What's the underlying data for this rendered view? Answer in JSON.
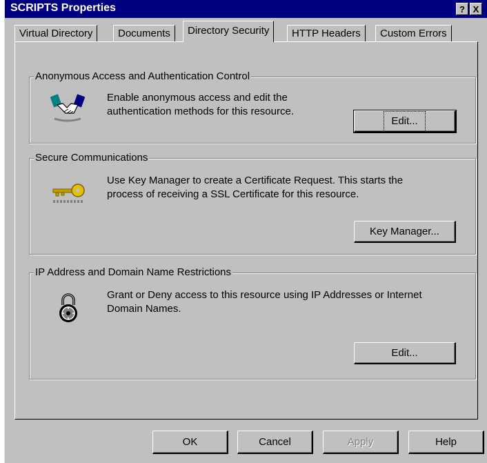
{
  "window": {
    "title": "SCRIPTS Properties"
  },
  "titlebar": {
    "help_label": "?",
    "close_label": "X"
  },
  "tabs": [
    {
      "label": "Virtual Directory"
    },
    {
      "label": "Documents"
    },
    {
      "label": "Directory Security"
    },
    {
      "label": "HTTP Headers"
    },
    {
      "label": "Custom Errors"
    }
  ],
  "sections": {
    "anonymous": {
      "title": "Anonymous Access and Authentication Control",
      "description": [
        "Enable anonymous access and edit the",
        "authentication methods for this resource."
      ],
      "button": "Edit...",
      "icon": "handshake-icon"
    },
    "secure": {
      "title": "Secure Communications",
      "description": [
        "Use Key Manager to create a Certificate Request.  This starts the",
        "process of receiving a SSL Certificate for this resource."
      ],
      "button": "Key Manager...",
      "icon": "key-icon"
    },
    "ip": {
      "title": "IP Address and Domain Name Restrictions",
      "description": [
        "Grant or Deny access to this resource using IP Addresses or Internet",
        "Domain Names."
      ],
      "button": "Edit...",
      "icon": "padlock-icon"
    }
  },
  "footer": {
    "ok": "OK",
    "cancel": "Cancel",
    "apply": "Apply",
    "help": "Help"
  }
}
